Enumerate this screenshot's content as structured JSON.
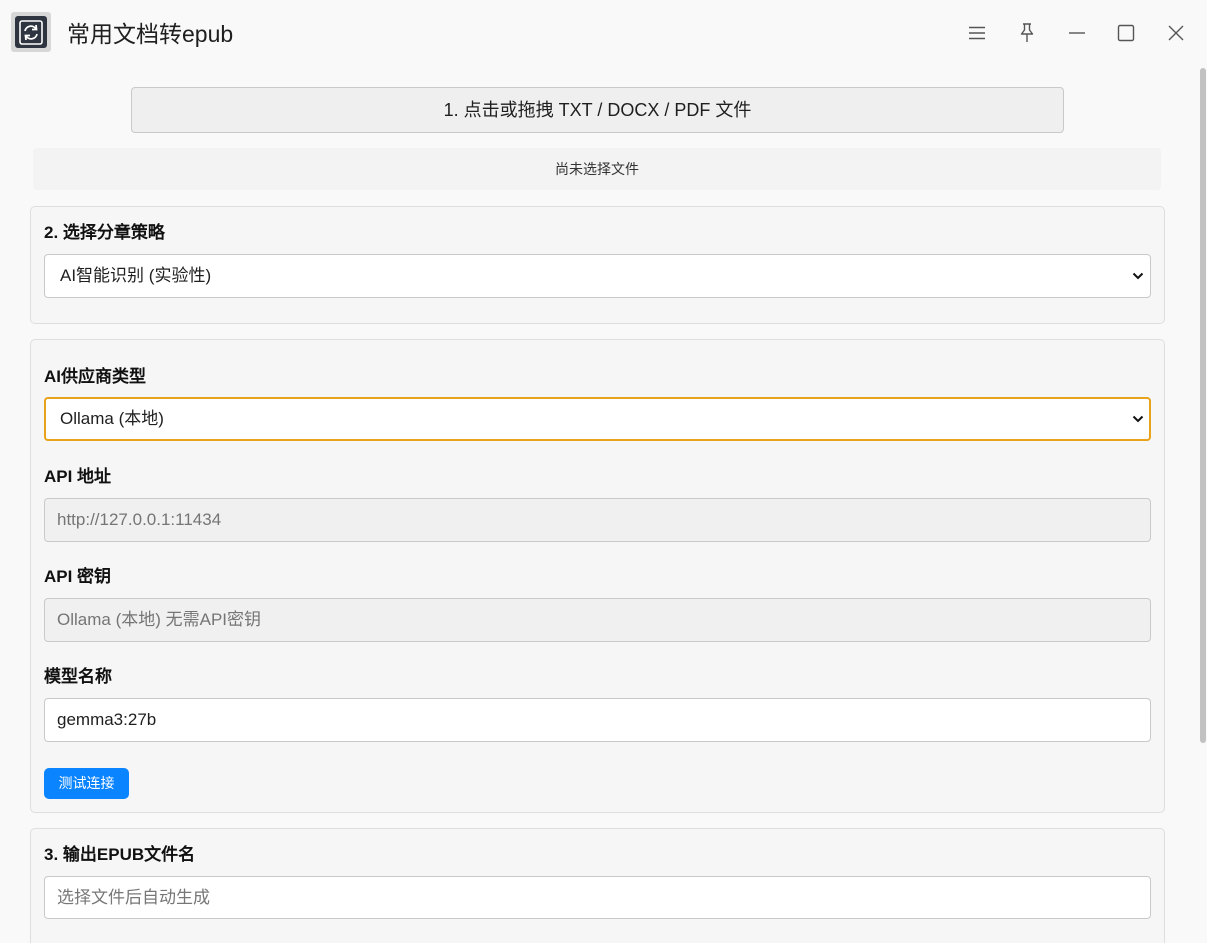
{
  "window": {
    "title": "常用文档转epub",
    "app_icon": "refresh-book-icon",
    "controls": [
      "menu-icon",
      "pin-icon",
      "minimize-icon",
      "maximize-icon",
      "close-icon"
    ]
  },
  "upload": {
    "button_label": "1. 点击或拖拽 TXT / DOCX / PDF 文件",
    "status": "尚未选择文件"
  },
  "strategy": {
    "heading": "2. 选择分章策略",
    "selected": "AI智能识别 (实验性)"
  },
  "ai": {
    "provider_label": "AI供应商类型",
    "provider_selected": "Ollama (本地)",
    "api_url_label": "API 地址",
    "api_url_value": "http://127.0.0.1:11434",
    "api_key_label": "API 密钥",
    "api_key_placeholder": "Ollama (本地) 无需API密钥",
    "model_label": "模型名称",
    "model_value": "gemma3:27b",
    "test_button": "测试连接"
  },
  "output": {
    "heading": "3. 输出EPUB文件名",
    "placeholder": "选择文件后自动生成"
  },
  "colors": {
    "accent": "#0b84ff",
    "focus_border": "#e8a31a",
    "background": "#f9f9f9"
  }
}
